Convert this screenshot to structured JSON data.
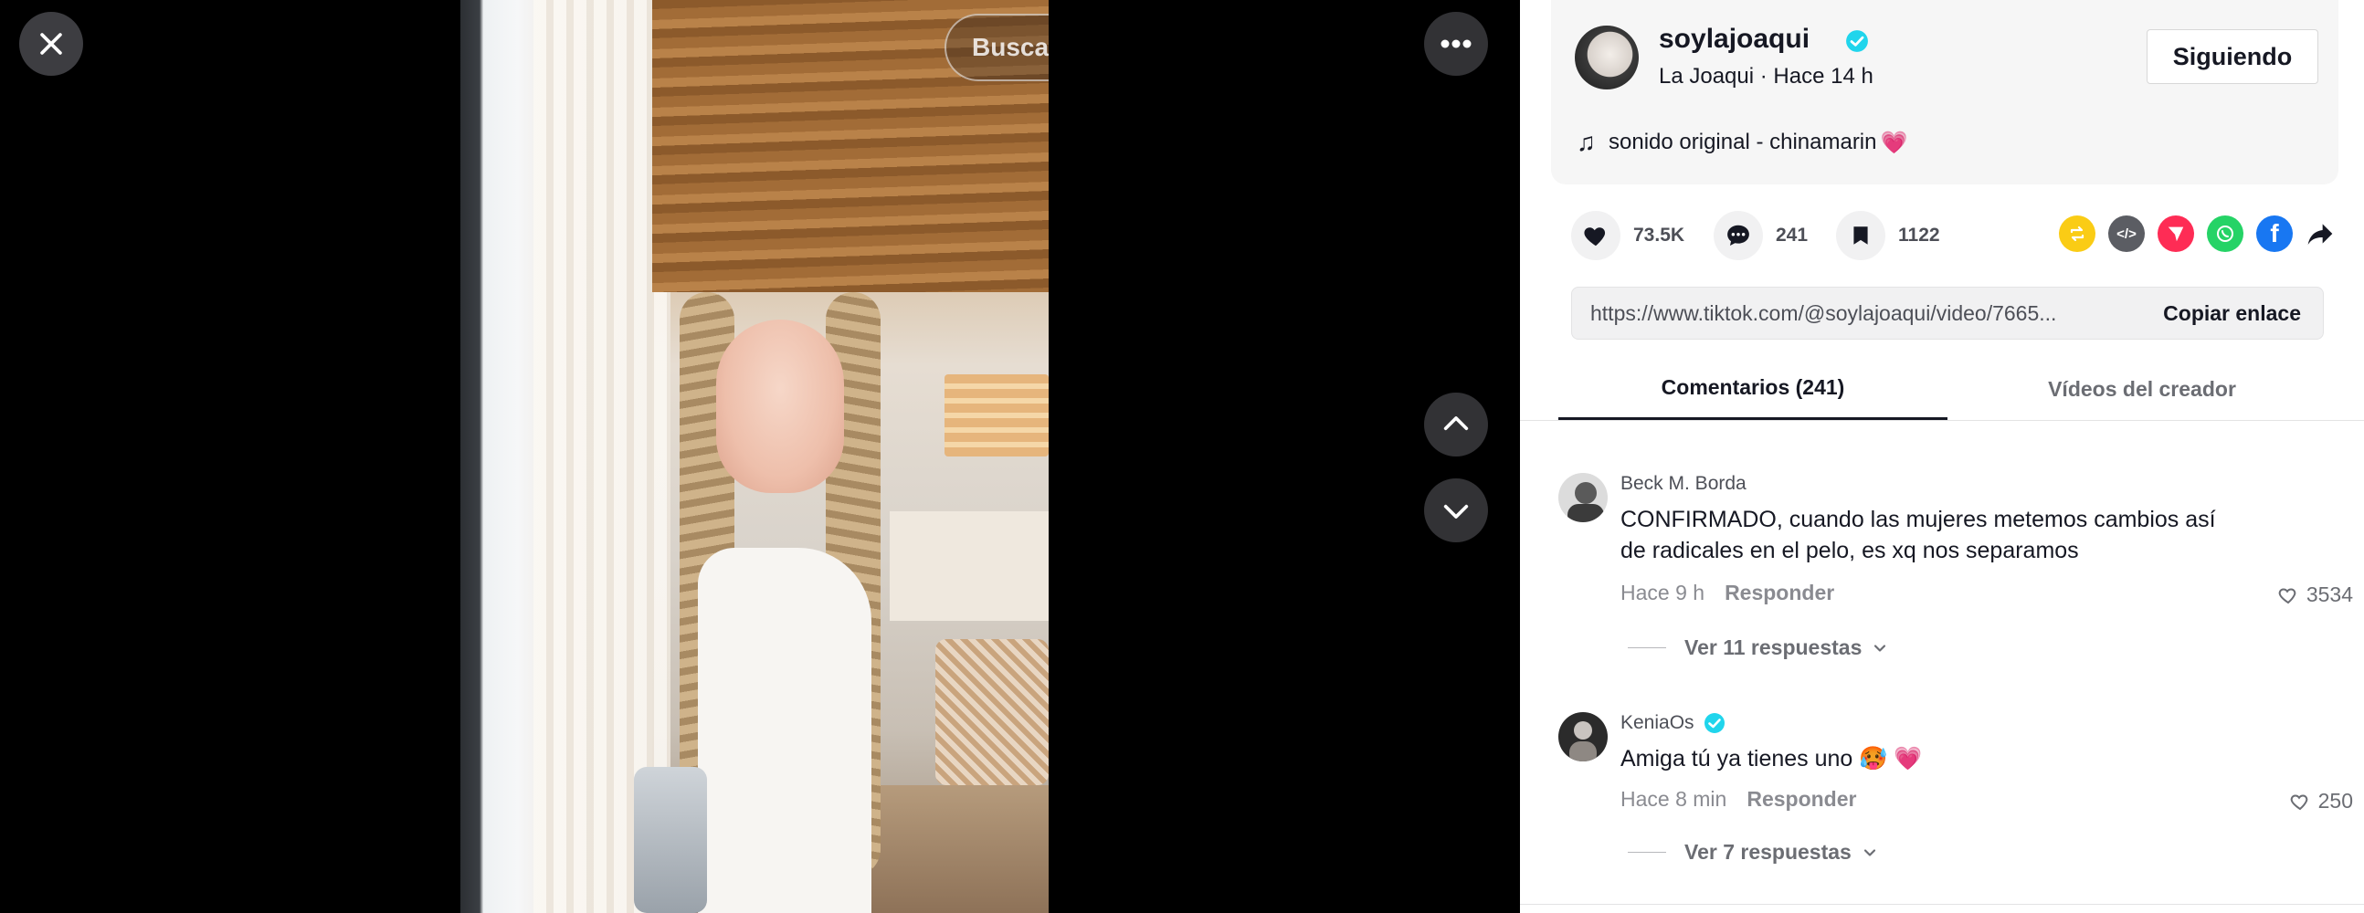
{
  "window": {
    "close_icon": "close-icon",
    "more_icon": "more-horizontal-icon",
    "prev_icon": "chevron-up-icon",
    "next_icon": "chevron-down-icon"
  },
  "search": {
    "placeholder": "Buscar contenido relacionado",
    "icon": "search-icon"
  },
  "author": {
    "username": "soylajoaqui",
    "verified": true,
    "display_name": "La Joaqui",
    "separator": " · ",
    "time_ago": "Hace 14 h",
    "follow_label": "Siguiendo",
    "music_icon": "music-note-icon",
    "music": "sonido original - chinamarin",
    "music_emoji": "💗"
  },
  "stats": {
    "likes": "73.5K",
    "comments": "241",
    "saves": "1122"
  },
  "share_icons": [
    "repost-icon",
    "embed-icon",
    "send-icon",
    "whatsapp-icon",
    "facebook-icon",
    "share-icon"
  ],
  "link": {
    "url": "https://www.tiktok.com/@soylajoaqui/video/7665...",
    "copy_label": "Copiar enlace"
  },
  "tabs": [
    {
      "label": "Comentarios (241)",
      "active": true
    },
    {
      "label": "Vídeos del creador",
      "active": false
    }
  ],
  "comments": [
    {
      "user": "Beck M. Borda",
      "verified": false,
      "text": "CONFIRMADO, cuando las mujeres metemos cambios así de radicales en el pelo, es xq nos separamos",
      "time": "Hace 9 h",
      "reply_label": "Responder",
      "likes": "3534",
      "view_replies": "Ver 11 respuestas"
    },
    {
      "user": "KeniaOs",
      "verified": true,
      "text": "Amiga tú ya tienes uno 🥵 💗",
      "time": "Hace 8 min",
      "reply_label": "Responder",
      "likes": "250",
      "view_replies": "Ver 7 respuestas"
    }
  ],
  "colors": {
    "accent": "#fe2c55",
    "verified": "#20d5ec",
    "text_primary": "#161823",
    "text_secondary": "#8a8b91"
  }
}
